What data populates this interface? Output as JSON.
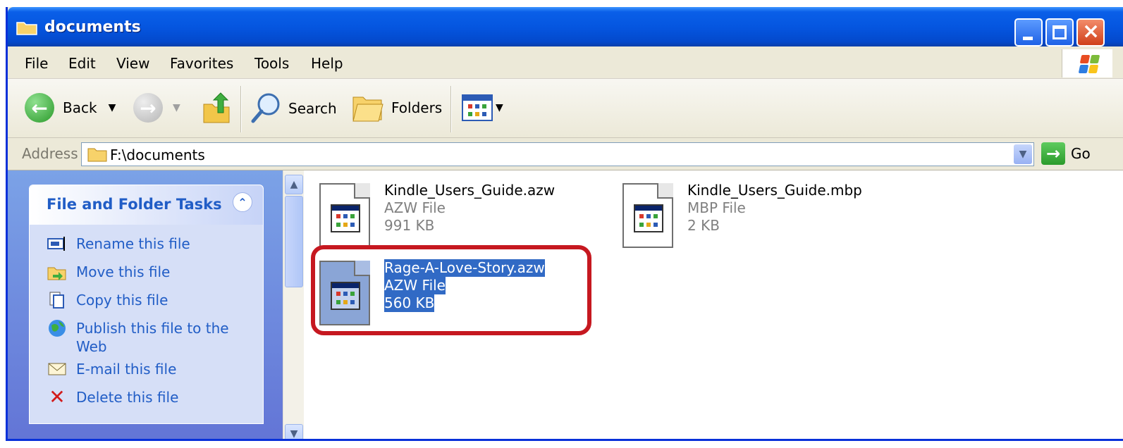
{
  "window": {
    "title": "documents",
    "controls": {
      "minimize": "minimize",
      "maximize": "maximize",
      "close": "×"
    }
  },
  "menu": [
    "File",
    "Edit",
    "View",
    "Favorites",
    "Tools",
    "Help"
  ],
  "toolbar": {
    "back_label": "Back",
    "search_label": "Search",
    "folders_label": "Folders"
  },
  "address": {
    "label": "Address",
    "value": "F:\\documents",
    "go_label": "Go"
  },
  "task_panel": {
    "title": "File and Folder Tasks",
    "tasks": [
      {
        "label": "Rename this file",
        "icon": "rename-icon"
      },
      {
        "label": "Move this file",
        "icon": "move-icon"
      },
      {
        "label": "Copy this file",
        "icon": "copy-icon"
      },
      {
        "label": "Publish this file to the Web",
        "icon": "publish-icon"
      },
      {
        "label": "E-mail this file",
        "icon": "email-icon"
      },
      {
        "label": "Delete this file",
        "icon": "delete-icon"
      }
    ]
  },
  "files": [
    {
      "name": "Kindle_Users_Guide.azw",
      "type": "AZW File",
      "size": "991 KB",
      "selected": false
    },
    {
      "name": "Kindle_Users_Guide.mbp",
      "type": "MBP File",
      "size": "2 KB",
      "selected": false
    },
    {
      "name": "Rage-A-Love-Story.azw",
      "type": "AZW File",
      "size": "560 KB",
      "selected": true
    }
  ],
  "colors": {
    "title_bar": "#0556E0",
    "task_link": "#215DC6",
    "selection": "#316AC5",
    "highlight_box": "#C61820"
  }
}
